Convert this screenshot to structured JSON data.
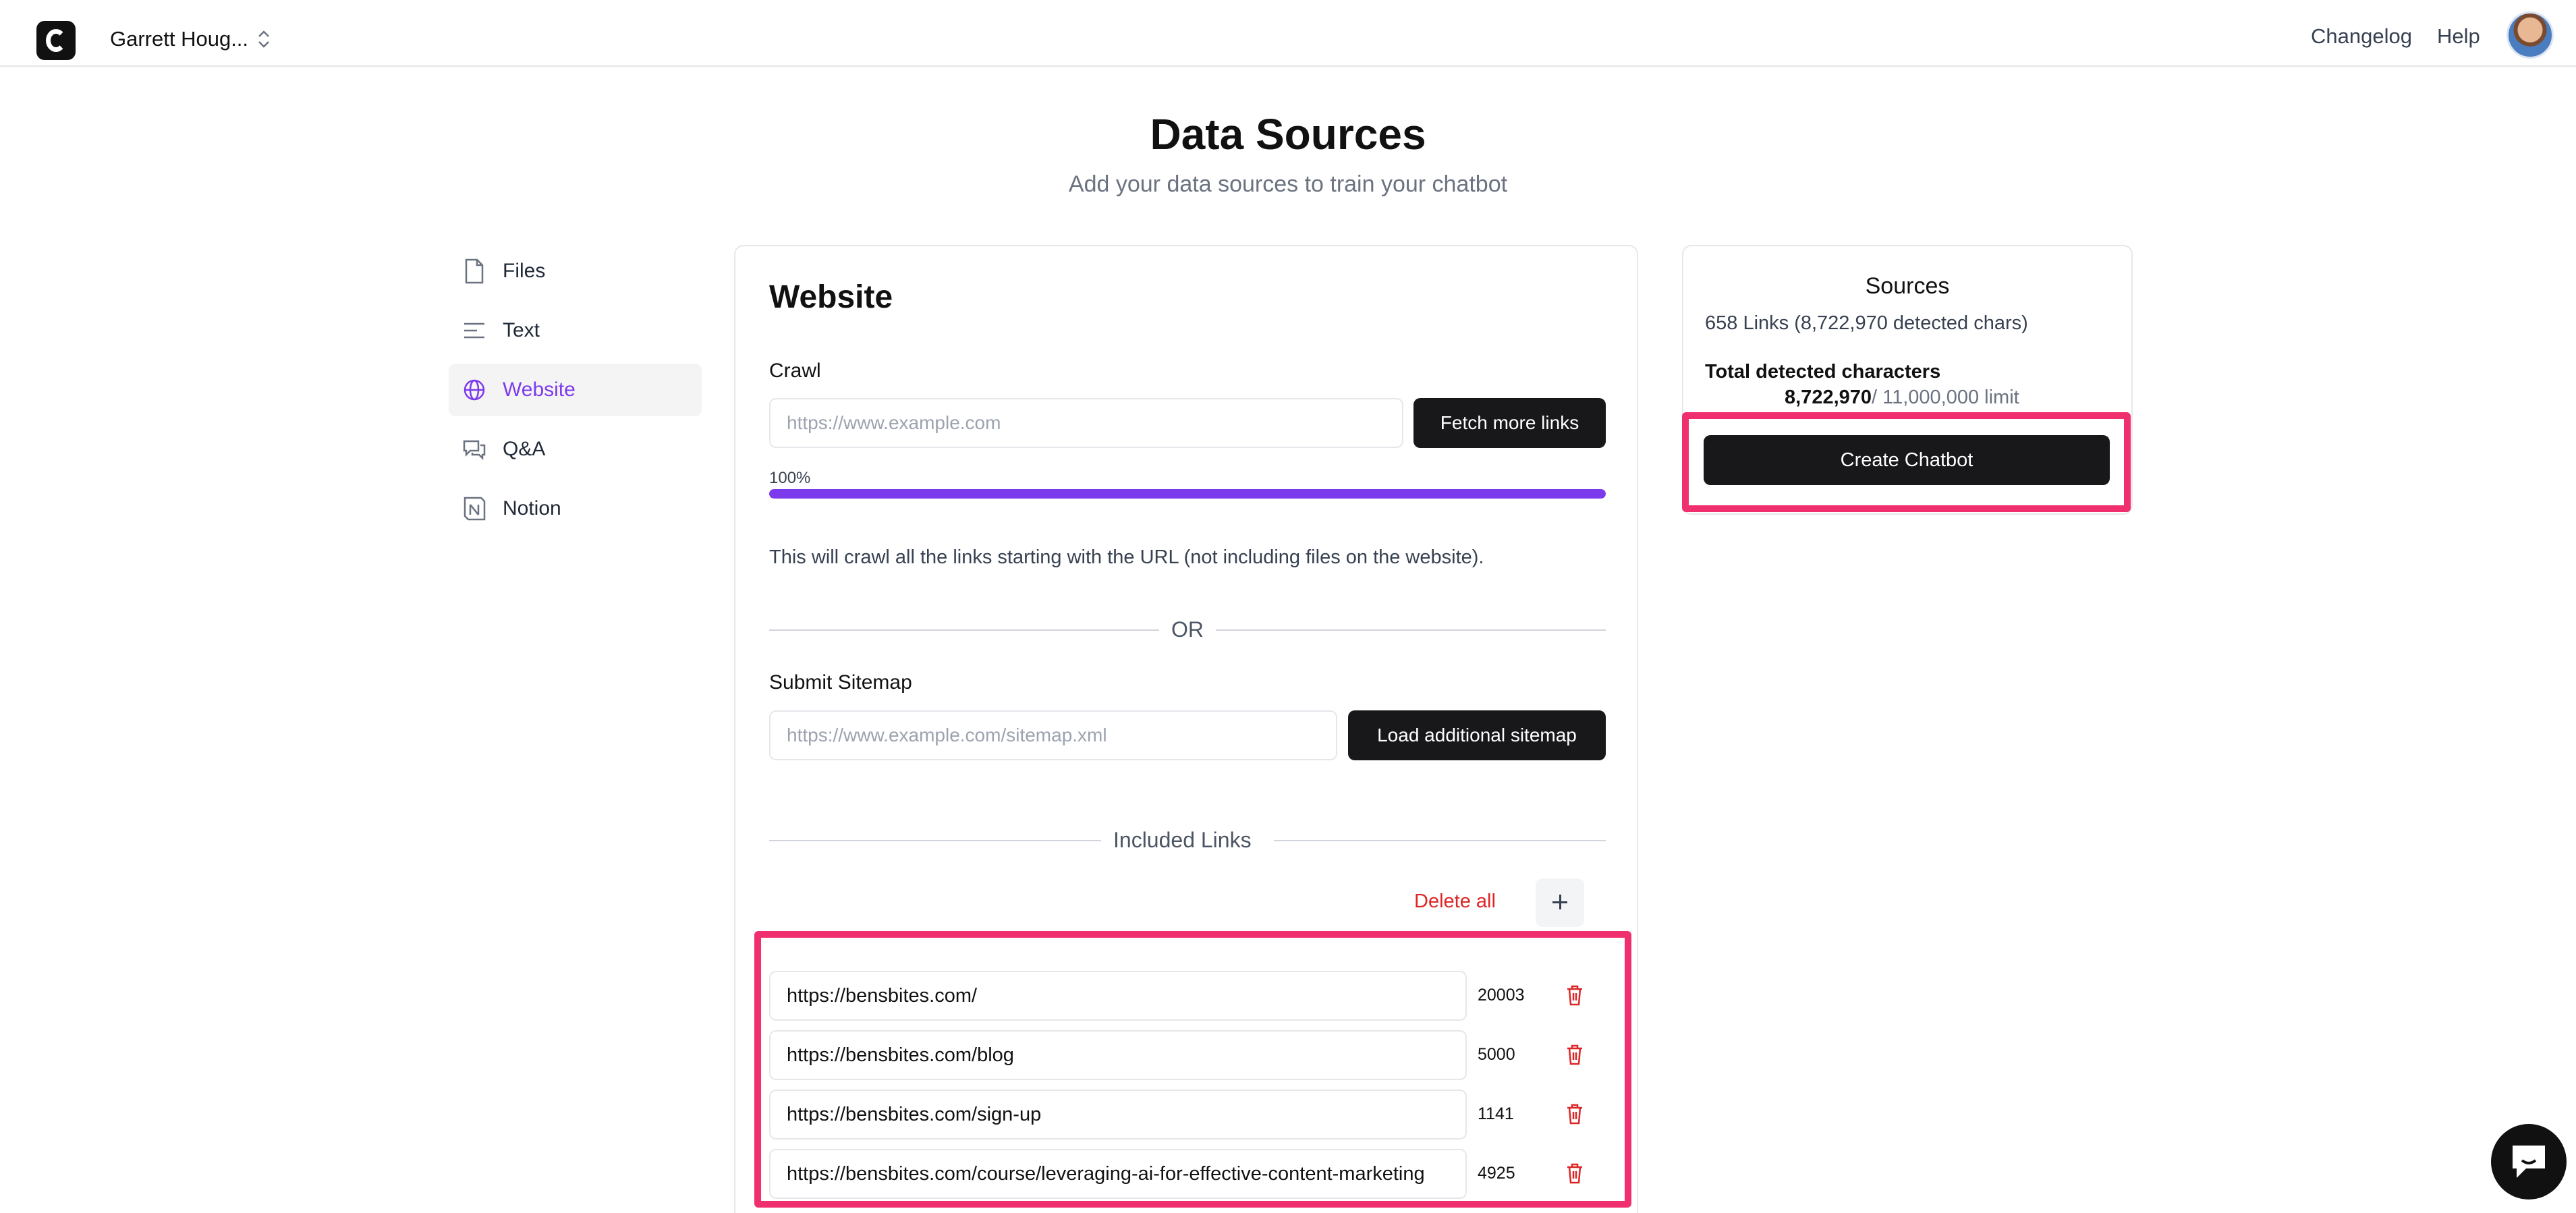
{
  "header": {
    "team_name": "Garrett Houg...",
    "changelog_label": "Changelog",
    "help_label": "Help"
  },
  "page": {
    "title": "Data Sources",
    "subtitle": "Add your data sources to train your chatbot"
  },
  "sidebar": {
    "items": [
      {
        "label": "Files",
        "icon": "file-icon"
      },
      {
        "label": "Text",
        "icon": "text-lines-icon"
      },
      {
        "label": "Website",
        "icon": "globe-icon",
        "active": true
      },
      {
        "label": "Q&A",
        "icon": "chat-bubbles-icon"
      },
      {
        "label": "Notion",
        "icon": "notion-icon"
      }
    ]
  },
  "website": {
    "title": "Website",
    "crawl_label": "Crawl",
    "crawl_placeholder": "https://www.example.com",
    "fetch_button": "Fetch more links",
    "progress_label": "100%",
    "progress_percent": 100,
    "help_text": "This will crawl all the links starting with the URL (not including files on the website).",
    "or_label": "OR",
    "sitemap_label": "Submit Sitemap",
    "sitemap_placeholder": "https://www.example.com/sitemap.xml",
    "sitemap_button": "Load additional sitemap",
    "included_links_label": "Included Links",
    "delete_all_label": "Delete all",
    "links": [
      {
        "url": "https://bensbites.com/",
        "chars": "20003"
      },
      {
        "url": "https://bensbites.com/blog",
        "chars": "5000"
      },
      {
        "url": "https://bensbites.com/sign-up",
        "chars": "1141"
      },
      {
        "url": "https://bensbites.com/course/leveraging-ai-for-effective-content-marketing",
        "chars": "4925"
      }
    ]
  },
  "sources": {
    "title": "Sources",
    "links_summary": "658 Links (8,722,970 detected chars)",
    "total_label": "Total detected characters",
    "count_value": "8,722,970",
    "count_limit": "/ 11,000,000 limit",
    "create_button": "Create Chatbot"
  },
  "colors": {
    "accent": "#7c3aed",
    "button": "#18181b",
    "danger": "#dc2626",
    "highlight": "#ef2f6e"
  }
}
